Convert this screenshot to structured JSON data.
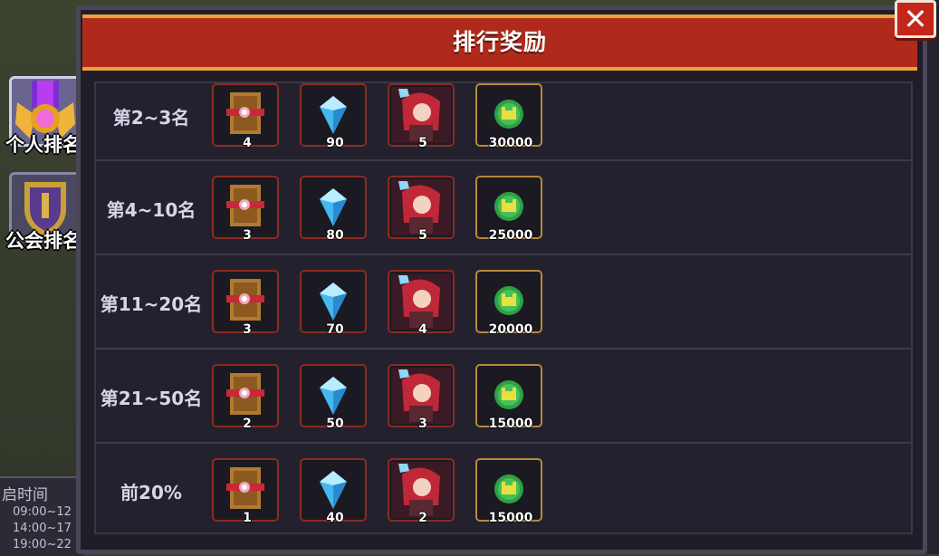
{
  "title": "排行奖励",
  "close_label": "✕",
  "tabs": [
    {
      "label": "个人排名",
      "icon": "medal-icon",
      "active": true
    },
    {
      "label": "公会排名",
      "icon": "shield-icon",
      "active": false
    }
  ],
  "background": {
    "time_title": "启时间",
    "times": [
      "09:00~12",
      "14:00~17",
      "19:00~22"
    ]
  },
  "reward_icons": [
    "book-icon",
    "diamond-icon",
    "hero-portrait-icon",
    "gold-coin-icon"
  ],
  "rows": [
    {
      "rank": "第2~3名",
      "counts": [
        "4",
        "90",
        "5",
        "30000"
      ]
    },
    {
      "rank": "第4~10名",
      "counts": [
        "3",
        "80",
        "5",
        "25000"
      ]
    },
    {
      "rank": "第11~20名",
      "counts": [
        "3",
        "70",
        "4",
        "20000"
      ]
    },
    {
      "rank": "第21~50名",
      "counts": [
        "2",
        "50",
        "3",
        "15000"
      ]
    },
    {
      "rank": "前20%",
      "counts": [
        "1",
        "40",
        "2",
        "15000"
      ]
    }
  ],
  "colors": {
    "header_red": "#b02a1b",
    "header_trim": "#e8a23c",
    "panel_bg": "#23212d",
    "item_border_red": "#8c2b22",
    "item_border_gold": "#b48a3a",
    "diamond_blue": "#45b8f0",
    "coin_green": "#2fa043"
  }
}
